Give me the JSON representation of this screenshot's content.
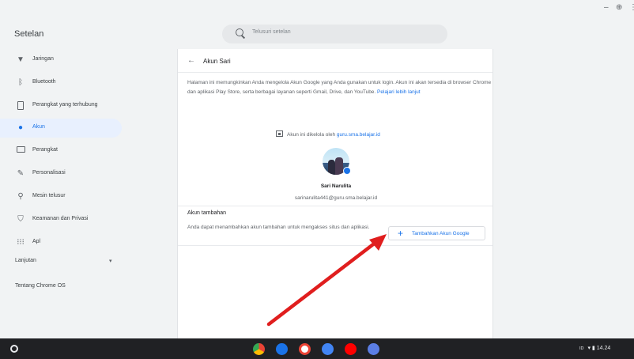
{
  "window": {
    "minimize_glyph": "–",
    "maximize_glyph": "⊕",
    "more_glyph": "⋮"
  },
  "header": {
    "title": "Setelan",
    "search_placeholder": "Telusuri setelan"
  },
  "sidebar": {
    "items": [
      {
        "label": "Jaringan",
        "icon": "wifi-icon"
      },
      {
        "label": "Bluetooth",
        "icon": "bluetooth-icon"
      },
      {
        "label": "Perangkat yang terhubung",
        "icon": "phone-icon"
      },
      {
        "label": "Akun",
        "icon": "person-icon",
        "active": true
      },
      {
        "label": "Perangkat",
        "icon": "laptop-icon"
      },
      {
        "label": "Personalisasi",
        "icon": "brush-icon"
      },
      {
        "label": "Mesin telusur",
        "icon": "search-icon"
      },
      {
        "label": "Keamanan dan Privasi",
        "icon": "shield-icon"
      },
      {
        "label": "Apl",
        "icon": "grid-icon"
      }
    ],
    "advanced_label": "Lanjutan",
    "about_label": "Tentang Chrome OS"
  },
  "main": {
    "title": "Akun Sari",
    "description": "Halaman ini memungkinkan Anda mengelola Akun Google yang Anda gunakan untuk login. Akun ini akan tersedia di browser Chrome dan aplikasi Play Store, serta berbagai layanan seperti Gmail, Drive, dan YouTube.",
    "learn_more": "Pelajari lebih lanjut",
    "managed_prefix": "Akun ini dikelola oleh",
    "managed_domain": "guru.sma.belajar.id",
    "user_name": "Sari Narulita",
    "user_email": "sarinarulita441@guru.sma.belajar.id",
    "additional_title": "Akun tambahan",
    "additional_desc": "Anda dapat menambahkan akun tambahan untuk mengakses situs dan aplikasi.",
    "add_button_label": "Tambahkan Akun Google"
  },
  "taskbar": {
    "apps": [
      {
        "name": "chrome-icon",
        "color": "#ea4335"
      },
      {
        "name": "files-icon",
        "color": "#1a73e8"
      },
      {
        "name": "gmail-icon",
        "color": "#4285f4"
      },
      {
        "name": "docs-icon",
        "color": "#4285f4"
      },
      {
        "name": "youtube-icon",
        "color": "#ff0000"
      },
      {
        "name": "settings-icon",
        "color": "#5b7ee5"
      }
    ],
    "input_method": "ID",
    "time": "14.24"
  },
  "colors": {
    "accent": "#1a73e8",
    "annotation_arrow": "#e01e1e"
  }
}
